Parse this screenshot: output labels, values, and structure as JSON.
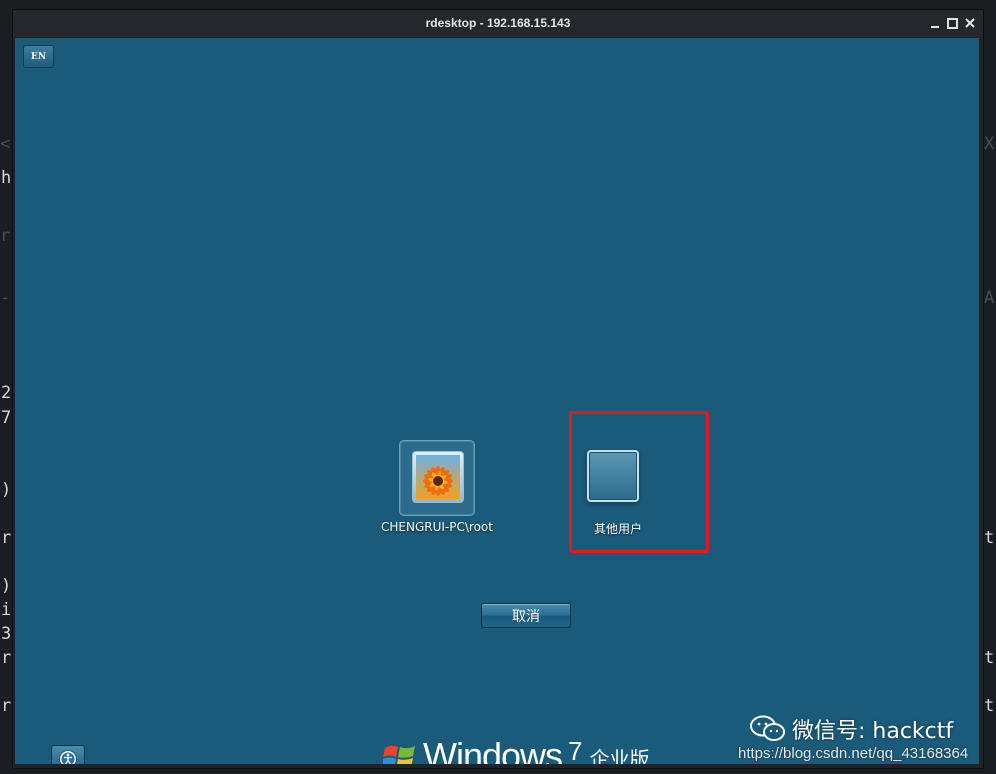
{
  "background_terminal": {
    "left_chars": [
      "h",
      "2",
      "7",
      ")",
      "r",
      ")",
      "i",
      "3",
      "r",
      "r"
    ],
    "right_chars": [
      "t",
      "t",
      "t"
    ]
  },
  "window": {
    "title": "rdesktop - 192.168.15.143",
    "controls": [
      "minimize",
      "maximize",
      "close"
    ]
  },
  "login_screen": {
    "language_indicator": "EN",
    "users": [
      {
        "label": "CHENGRUI-PC\\root",
        "picture": "orange-flower",
        "selected": true
      },
      {
        "label": "其他用户",
        "picture": "empty"
      }
    ],
    "cancel_label": "取消",
    "brand_word": "Windows",
    "brand_version": "7",
    "brand_edition": "企业版",
    "highlight_color": "#e5191b",
    "background_color": "#1a5a7a"
  },
  "watermarks": {
    "wechat_text": "微信号: hackctf",
    "csdn_url": "https://blog.csdn.net/qq_43168364"
  }
}
